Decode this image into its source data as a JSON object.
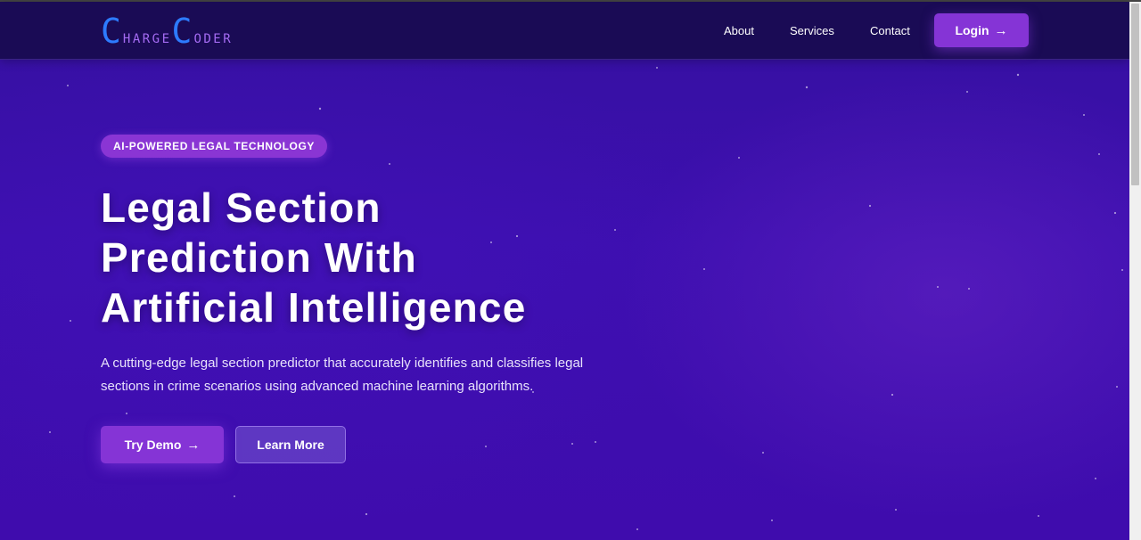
{
  "logo": {
    "first_big": "C",
    "first_rest": "HARGE",
    "second_big": "C",
    "second_rest": "ODER"
  },
  "nav": {
    "items": [
      {
        "label": "About"
      },
      {
        "label": "Services"
      },
      {
        "label": "Contact"
      }
    ],
    "login_label": "Login",
    "arrow": "→"
  },
  "hero": {
    "badge": "AI-POWERED LEGAL TECHNOLOGY",
    "headline_lines": [
      "Legal Section",
      "Prediction With",
      "Artificial Intelligence"
    ],
    "subtitle": "A cutting-edge legal section predictor that accurately identifies and classifies legal sections in crime scenarios using advanced machine learning algorithms.",
    "primary_button": "Try Demo",
    "secondary_button": "Learn More",
    "arrow": "→"
  },
  "colors": {
    "background": "#3d0fb0",
    "navbar": "#1a0b55",
    "accent": "#8534d6",
    "logo_primary": "#2d7bff",
    "logo_secondary": "#a46bf2"
  }
}
